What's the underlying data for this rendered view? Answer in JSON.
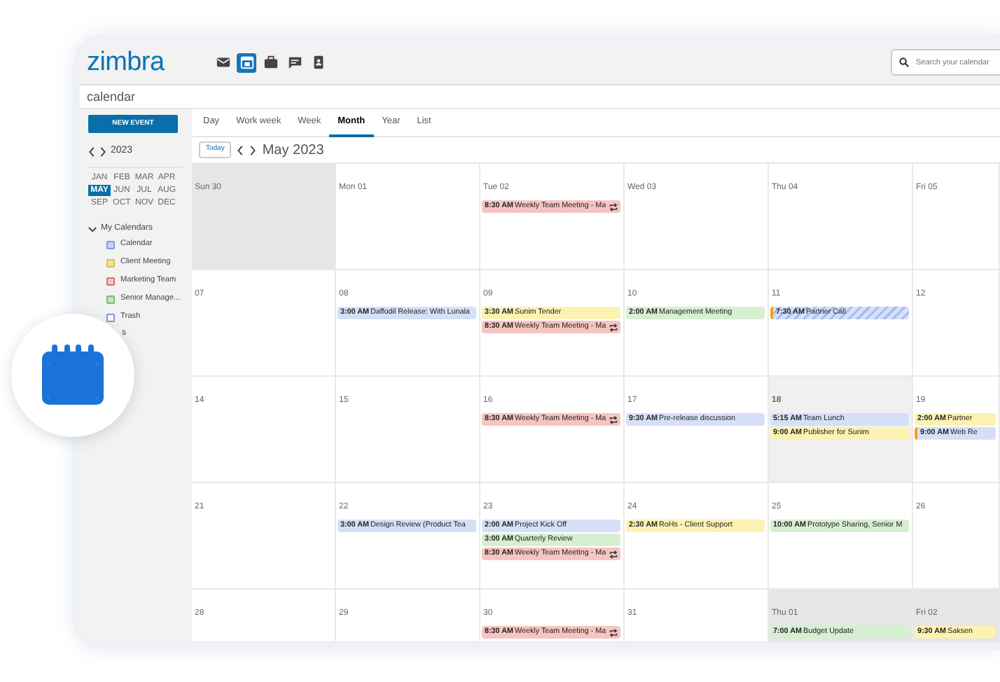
{
  "app": {
    "logo": "zimbra",
    "section_title": "calendar"
  },
  "apps": [
    {
      "kind": "mail",
      "selected": false
    },
    {
      "kind": "calendar",
      "selected": true
    },
    {
      "kind": "briefcase",
      "selected": false
    },
    {
      "kind": "chat",
      "selected": false
    },
    {
      "kind": "contacts",
      "selected": false
    }
  ],
  "search": {
    "placeholder": "Search your calendar"
  },
  "sidebar": {
    "new_event": "NEW EVENT",
    "year": "2023",
    "months": [
      {
        "label": "JAN",
        "selected": false
      },
      {
        "label": "FEB",
        "selected": false
      },
      {
        "label": "MAR",
        "selected": false
      },
      {
        "label": "APR",
        "selected": false
      },
      {
        "label": "MAY",
        "selected": true
      },
      {
        "label": "JUN",
        "selected": false
      },
      {
        "label": "JUL",
        "selected": false
      },
      {
        "label": "AUG",
        "selected": false
      },
      {
        "label": "SEP",
        "selected": false
      },
      {
        "label": "OCT",
        "selected": false
      },
      {
        "label": "NOV",
        "selected": false
      },
      {
        "label": "DEC",
        "selected": false
      }
    ],
    "group": {
      "label": "My Calendars",
      "expanded": true
    },
    "calendars": [
      {
        "label": "Calendar",
        "color": "#7b9be0",
        "checked": true
      },
      {
        "label": "Client Meeting",
        "color": "#d8c23a",
        "checked": true
      },
      {
        "label": "Marketing Team",
        "color": "#e0706a",
        "checked": true
      },
      {
        "label": "Senior Manage...",
        "color": "#79bb6e",
        "checked": true
      },
      {
        "label": "Trash",
        "color": "#7b9be0",
        "checked": false
      }
    ],
    "partial_label": "s"
  },
  "views": [
    {
      "label": "Day",
      "selected": false
    },
    {
      "label": "Work week",
      "selected": false
    },
    {
      "label": "Week",
      "selected": false
    },
    {
      "label": "Month",
      "selected": true
    },
    {
      "label": "Year",
      "selected": false
    },
    {
      "label": "List",
      "selected": false
    }
  ],
  "toolbar": {
    "today": "Today",
    "title": "May 2023"
  },
  "weeks": [
    [
      {
        "label": "Sun 30",
        "other_month": true,
        "today": false
      },
      {
        "label": "Mon 01",
        "other_month": false,
        "today": false
      },
      {
        "label": "Tue 02",
        "other_month": false,
        "today": false,
        "events": [
          {
            "time": "8:30 AM",
            "title": "Weekly Team Meeting - Ma",
            "color": "#f7c5c1",
            "recurring": true,
            "kind": "normal"
          }
        ]
      },
      {
        "label": "Wed 03",
        "other_month": false,
        "today": false
      },
      {
        "label": "Thu 04",
        "other_month": false,
        "today": false
      },
      {
        "label": "Fri 05",
        "other_month": false,
        "today": false
      }
    ],
    [
      {
        "label": "07",
        "other_month": false,
        "today": false
      },
      {
        "label": "08",
        "other_month": false,
        "today": false,
        "events": [
          {
            "time": "3:00 AM",
            "title": "Daffodil Release: With Lunala",
            "color": "#d5e0f7",
            "recurring": false,
            "kind": "normal"
          }
        ]
      },
      {
        "label": "09",
        "other_month": false,
        "today": false,
        "events": [
          {
            "time": "3:30 AM",
            "title": "Sunim Tender",
            "color": "#fcf2b2",
            "recurring": false,
            "kind": "normal"
          },
          {
            "time": "8:30 AM",
            "title": "Weekly Team Meeting - Ma",
            "color": "#f7c5c1",
            "recurring": true,
            "kind": "normal"
          }
        ]
      },
      {
        "label": "10",
        "other_month": false,
        "today": false,
        "events": [
          {
            "time": "2:00 AM",
            "title": "Management Meeting",
            "color": "#d6efd0",
            "recurring": false,
            "kind": "normal"
          }
        ]
      },
      {
        "label": "11",
        "other_month": false,
        "today": false,
        "events": [
          {
            "time": "7:30 AM",
            "title": "Partner Call",
            "color": "#d5e0f7",
            "recurring": false,
            "kind": "tentative"
          }
        ]
      },
      {
        "label": "12",
        "other_month": false,
        "today": false
      }
    ],
    [
      {
        "label": "14",
        "other_month": false,
        "today": false
      },
      {
        "label": "15",
        "other_month": false,
        "today": false
      },
      {
        "label": "16",
        "other_month": false,
        "today": false,
        "events": [
          {
            "time": "8:30 AM",
            "title": "Weekly Team Meeting - Ma",
            "color": "#f7c5c1",
            "recurring": true,
            "kind": "normal"
          }
        ]
      },
      {
        "label": "17",
        "other_month": false,
        "today": false,
        "events": [
          {
            "time": "9:30 AM",
            "title": "Pre-release discussion",
            "color": "#d5e0f7",
            "recurring": false,
            "kind": "normal"
          }
        ]
      },
      {
        "label": "18",
        "other_month": false,
        "today": true,
        "events": [
          {
            "time": "5:15 AM",
            "title": "Team Lunch",
            "color": "#d5e0f7",
            "recurring": false,
            "kind": "normal"
          },
          {
            "time": "9:00 AM",
            "title": "Publisher for Sunim",
            "color": "#fcf2b2",
            "recurring": false,
            "kind": "normal"
          }
        ]
      },
      {
        "label": "19",
        "other_month": false,
        "today": false,
        "events": [
          {
            "time": "2:00 AM",
            "title": "Partner",
            "color": "#fcf2b2",
            "recurring": false,
            "kind": "normal"
          },
          {
            "time": "9:00 AM",
            "title": "Web Re",
            "color": "#d5e0f7",
            "recurring": false,
            "kind": "flagged"
          }
        ]
      }
    ],
    [
      {
        "label": "21",
        "other_month": false,
        "today": false
      },
      {
        "label": "22",
        "other_month": false,
        "today": false,
        "events": [
          {
            "time": "3:00 AM",
            "title": "Design Review (Product Tea",
            "color": "#d5e0f7",
            "recurring": false,
            "kind": "normal"
          }
        ]
      },
      {
        "label": "23",
        "other_month": false,
        "today": false,
        "events": [
          {
            "time": "2:00 AM",
            "title": "Project Kick Off",
            "color": "#d5e0f7",
            "recurring": false,
            "kind": "normal"
          },
          {
            "time": "3:00 AM",
            "title": "Quarterly Review",
            "color": "#d6efd0",
            "recurring": false,
            "kind": "normal"
          },
          {
            "time": "8:30 AM",
            "title": "Weekly Team Meeting - Ma",
            "color": "#f7c5c1",
            "recurring": true,
            "kind": "normal"
          }
        ]
      },
      {
        "label": "24",
        "other_month": false,
        "today": false,
        "events": [
          {
            "time": "2:30 AM",
            "title": "RoHs - Client Support",
            "color": "#fcf2b2",
            "recurring": false,
            "kind": "normal"
          }
        ]
      },
      {
        "label": "25",
        "other_month": false,
        "today": false,
        "events": [
          {
            "time": "10:00 AM",
            "title": "Prototype Sharing, Senior M",
            "color": "#d6efd0",
            "recurring": false,
            "kind": "normal"
          }
        ]
      },
      {
        "label": "26",
        "other_month": false,
        "today": false
      }
    ],
    [
      {
        "label": "28",
        "other_month": false,
        "today": false
      },
      {
        "label": "29",
        "other_month": false,
        "today": false
      },
      {
        "label": "30",
        "other_month": false,
        "today": false,
        "events": [
          {
            "time": "8:30 AM",
            "title": "Weekly Team Meeting - Ma",
            "color": "#f7c5c1",
            "recurring": true,
            "kind": "normal"
          }
        ]
      },
      {
        "label": "31",
        "other_month": false,
        "today": false
      },
      {
        "label": "Thu 01",
        "other_month": true,
        "today": false,
        "events": [
          {
            "time": "7:00 AM",
            "title": "Budget Update",
            "color": "#d6efd0",
            "recurring": false,
            "kind": "normal"
          }
        ]
      },
      {
        "label": "Fri 02",
        "other_month": true,
        "today": false,
        "events": [
          {
            "time": "9:30 AM",
            "title": "Saksen",
            "color": "#fcf2b2",
            "recurring": false,
            "kind": "normal"
          }
        ]
      }
    ]
  ]
}
